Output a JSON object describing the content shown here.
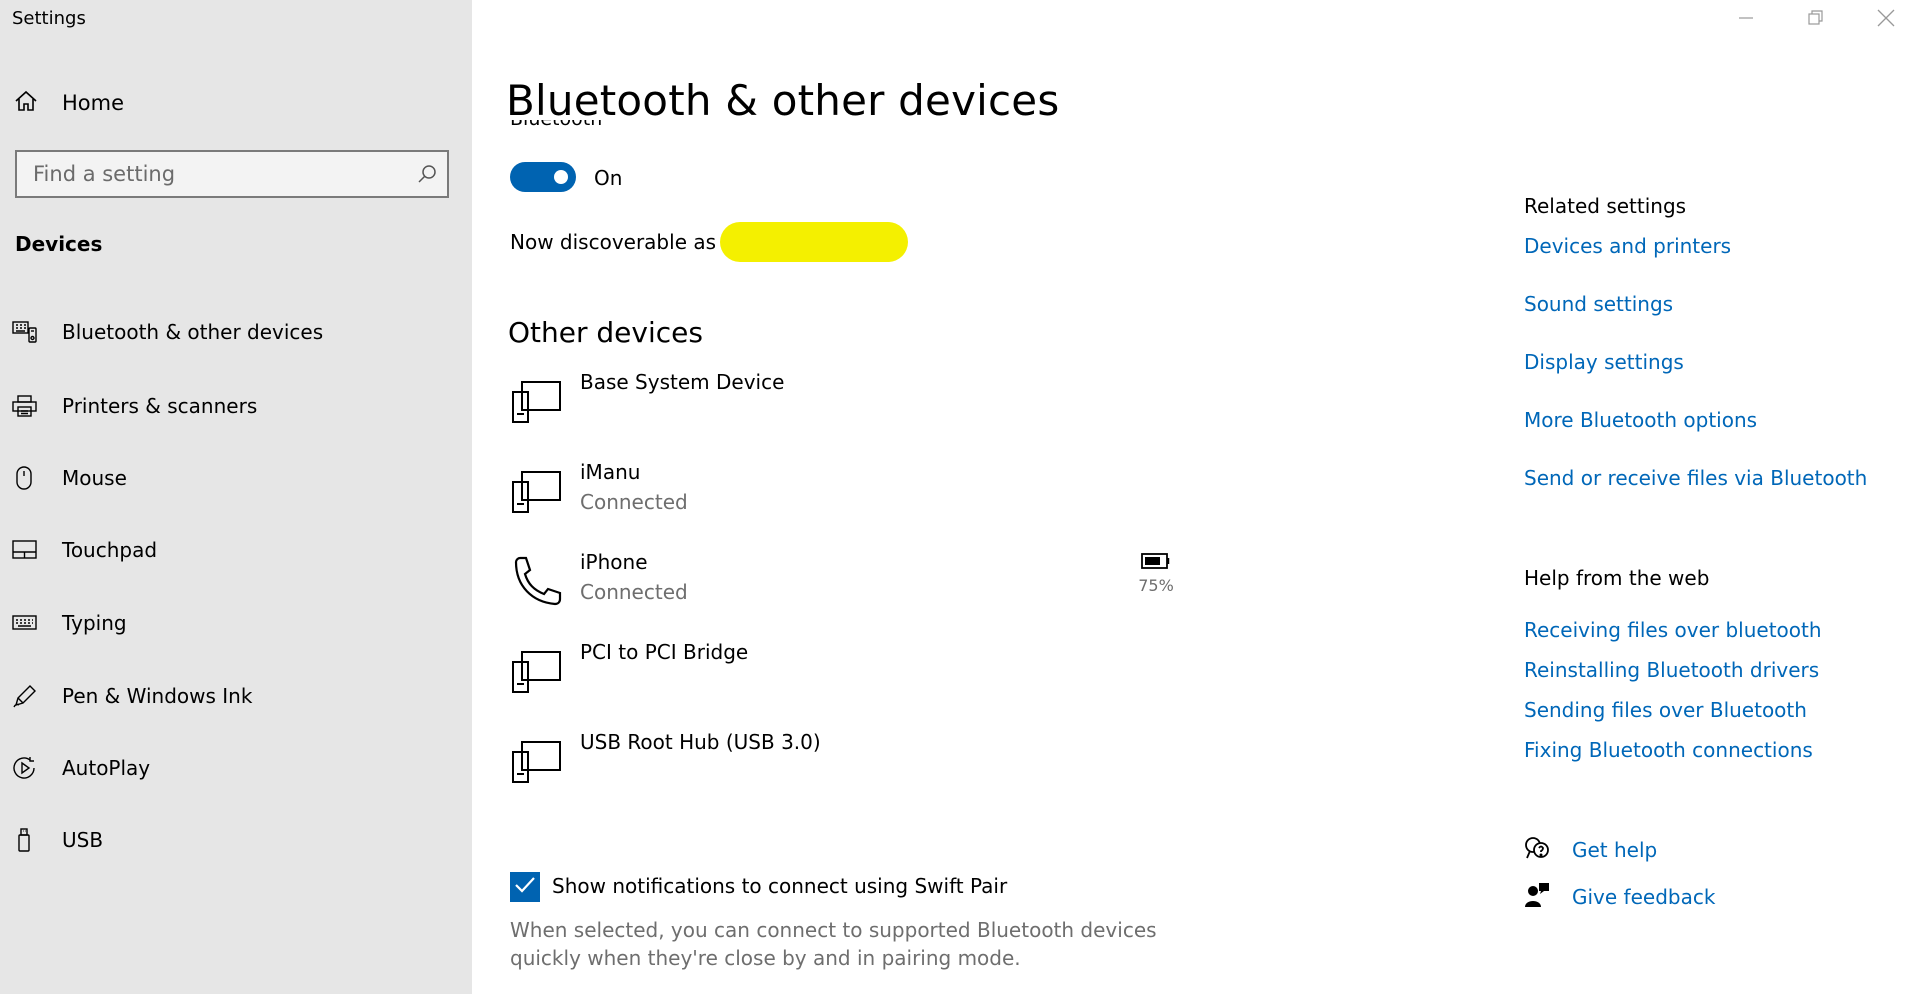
{
  "window": {
    "title": "Settings"
  },
  "sidebar": {
    "home_label": "Home",
    "search_placeholder": "Find a setting",
    "section": "Devices",
    "items": [
      {
        "label": "Bluetooth & other devices",
        "icon": "bluetooth-devices-icon"
      },
      {
        "label": "Printers & scanners",
        "icon": "printer-icon"
      },
      {
        "label": "Mouse",
        "icon": "mouse-icon"
      },
      {
        "label": "Touchpad",
        "icon": "touchpad-icon"
      },
      {
        "label": "Typing",
        "icon": "keyboard-icon"
      },
      {
        "label": "Pen & Windows Ink",
        "icon": "pen-icon"
      },
      {
        "label": "AutoPlay",
        "icon": "autoplay-icon"
      },
      {
        "label": "USB",
        "icon": "usb-icon"
      }
    ]
  },
  "main": {
    "title": "Bluetooth & other devices",
    "bluetooth_label": "Bluetooth",
    "toggle_state": "On",
    "discoverable_text": "Now discoverable as",
    "other_devices_title": "Other devices",
    "devices": [
      {
        "name": "Base System Device",
        "status": "",
        "icon": "device-icon"
      },
      {
        "name": "iManu",
        "status": "Connected",
        "icon": "device-icon"
      },
      {
        "name": "iPhone",
        "status": "Connected",
        "icon": "phone-icon",
        "battery": "75%"
      },
      {
        "name": "PCI to PCI Bridge",
        "status": "",
        "icon": "device-icon"
      },
      {
        "name": "USB Root Hub (USB 3.0)",
        "status": "",
        "icon": "device-icon"
      }
    ],
    "swift_pair_label": "Show notifications to connect using Swift Pair",
    "swift_pair_desc": "When selected, you can connect to supported Bluetooth devices quickly when they're close by and in pairing mode."
  },
  "related": {
    "title": "Related settings",
    "links": [
      "Devices and printers",
      "Sound settings",
      "Display settings",
      "More Bluetooth options",
      "Send or receive files via Bluetooth"
    ]
  },
  "help": {
    "title": "Help from the web",
    "links": [
      "Receiving files over bluetooth",
      "Reinstalling Bluetooth drivers",
      "Sending files over Bluetooth",
      "Fixing Bluetooth connections"
    ],
    "get_help": "Get help",
    "give_feedback": "Give feedback"
  },
  "colors": {
    "accent": "#0063b1",
    "link": "#0067b8",
    "sidebar_bg": "#e6e6e6",
    "redaction": "#f4f000"
  }
}
